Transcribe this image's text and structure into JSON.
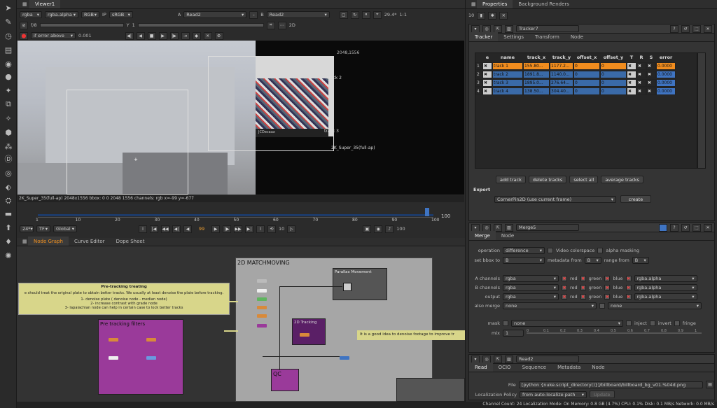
{
  "viewer": {
    "tab": "Viewer1",
    "channels": "rgba",
    "alpha": "rgba.alpha",
    "colorspace": "RGB",
    "ip": "IP",
    "lut": "sRGB",
    "input_a_label": "A",
    "input_a": "Read2",
    "input_b_label": "B",
    "input_b": "Read2",
    "fps": "29.4*",
    "zoom": "1:1",
    "fstop": "f/8",
    "frame": "1",
    "error_mode": "if error above",
    "threshold": "0.001",
    "mode2d": "2D",
    "res_label": "2048,1556",
    "track2": "track 2",
    "track3": "track 3",
    "format_overlay": "2K_Super_35(full-ap)",
    "brand": "JCDecaux",
    "status": "2K_Super_35(full-ap) 2048x1556  bbox: 0 0 2048 1556 channels: rgb      x=-99 y=-677"
  },
  "timeline": {
    "ticks": [
      "1",
      "10",
      "20",
      "30",
      "40",
      "50",
      "60",
      "70",
      "80",
      "90",
      "100"
    ],
    "end": "100",
    "fps": "24*",
    "tf": "TF",
    "global": "Global",
    "current": "99",
    "step": "10",
    "end2": "100"
  },
  "nodegraph": {
    "tabs": [
      "Node Graph",
      "Curve Editor",
      "Dope Sheet"
    ],
    "pretrack_title": "Pre-tracking treating",
    "pretrack_lines": [
      "e should treat the original plate to obtain better tracks. We usually at least denoise the plate before tracking.",
      "1- denoise plate ( denoise node - median node)",
      "2- increase contrast with grade node",
      "3- lapalachian node can help in certain case to lock better tracks"
    ],
    "pretrack_filters": "Pre tracking filters",
    "matchmoving": "2D MATCHMOVING",
    "parallax": "Parallax Movement",
    "tracking": "2D Tracking",
    "qc": "QC",
    "denoise_note": "It is a good idea to denoise footage to improve tr"
  },
  "properties": {
    "tabs": [
      "Properties",
      "Background Renders"
    ],
    "count": "10",
    "tracker": {
      "name": "Tracker7",
      "tabs": [
        "Tracker",
        "Settings",
        "Transform",
        "Node"
      ],
      "columns": [
        "e",
        "name",
        "track_x",
        "track_y",
        "offset_x",
        "offset_y",
        "T",
        "R",
        "S",
        "error"
      ],
      "rows": [
        {
          "n": "1",
          "name": "track 1",
          "x": "155.80...",
          "y": "1177.2...",
          "ox": "0",
          "oy": "0",
          "err": "0.0000"
        },
        {
          "n": "2",
          "name": "track 2",
          "x": "1891.8...",
          "y": "1140.0...",
          "ox": "0",
          "oy": "0",
          "err": "0.0000"
        },
        {
          "n": "3",
          "name": "track 3",
          "x": "1895.0...",
          "y": "276.64...",
          "ox": "0",
          "oy": "0",
          "err": "0.0000"
        },
        {
          "n": "4",
          "name": "track 4",
          "x": "138.50...",
          "y": "304.40...",
          "ox": "0",
          "oy": "0",
          "err": "0.0000"
        }
      ],
      "buttons": [
        "add track",
        "delete tracks",
        "select all",
        "average tracks"
      ],
      "export_label": "Export",
      "export_value": "CornerPin2D (use current frame)",
      "create": "create"
    },
    "merge": {
      "name": "Merge5",
      "tabs": [
        "Merge",
        "Node"
      ],
      "operation_label": "operation",
      "operation": "difference",
      "video_colorspace": "Video colorspace",
      "alpha_masking": "alpha masking",
      "bbox_label": "set bbox to",
      "bbox": "B",
      "metadata_label": "metadata from",
      "metadata": "B",
      "range_label": "range from",
      "range": "B",
      "a_label": "A channels",
      "b_label": "B channels",
      "out_label": "output",
      "chan": "rgba",
      "red": "red",
      "green": "green",
      "blue": "blue",
      "alpha": "rgba.alpha",
      "also_label": "also merge",
      "none": "none",
      "mask_label": "mask",
      "inject": "inject",
      "invert": "invert",
      "fringe": "fringe",
      "mix_label": "mix",
      "mix": "1",
      "mix_ticks": [
        "0",
        "0.1",
        "0.2",
        "0.3",
        "0.4",
        "0.5",
        "0.6",
        "0.7",
        "0.8",
        "0.9",
        "1"
      ]
    },
    "read": {
      "name": "Read2",
      "tabs": [
        "Read",
        "OCIO",
        "Sequence",
        "Metadata",
        "Node"
      ],
      "file_label": "File",
      "file": "[python {nuke.script_directory()}]/billboard/billboard_bg_v01.%04d.png",
      "loc_label": "Localization Policy",
      "loc": "from auto-localize path",
      "update": "Update"
    }
  },
  "statusbar": "Channel Count: 24  Localization Mode: On  Memory: 0.8 GB (4.7%)  CPU: 0.1%  Disk: 0.1 MB/s  Network: 0.0 MB/s",
  "colors": {
    "orange": "#f08c1e",
    "blue": "#3f74c2",
    "yellow": "#d8d68a",
    "purple": "#9a3a9a",
    "matchbg": "#a6a6a6"
  }
}
